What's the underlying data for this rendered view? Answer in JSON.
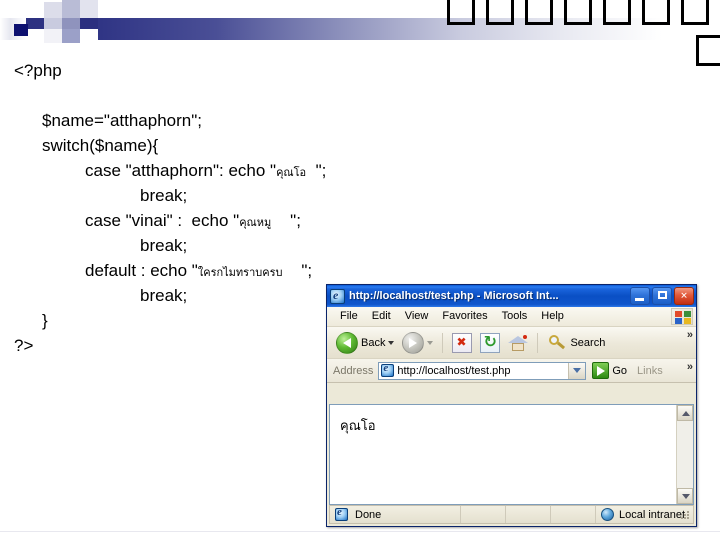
{
  "slide": {
    "title_boxes": 7,
    "title_box_extra": 1,
    "accent_color": "#2b2f7f"
  },
  "code": {
    "lines": [
      {
        "text": "<?php",
        "indent": 0,
        "thai": ""
      },
      {
        "text": "",
        "indent": 0,
        "thai": ""
      },
      {
        "text": "$name=\"atthaphorn\";",
        "indent": 1,
        "thai": ""
      },
      {
        "text": "switch($name){",
        "indent": 1,
        "thai": ""
      },
      {
        "text": "case \"atthaphorn\": echo \"",
        "indent": 2,
        "thai": "คุณโอ",
        "tail": "  \";"
      },
      {
        "text": "break;",
        "indent": 3,
        "thai": ""
      },
      {
        "text": "case \"vinai\" :  echo \"",
        "indent": 2,
        "thai": "คุณหมู",
        "tail": "    \";"
      },
      {
        "text": "break;",
        "indent": 3,
        "thai": ""
      },
      {
        "text": "default : echo \"",
        "indent": 2,
        "thai": "ใครกไมทราบครบ",
        "tail": "    \";"
      },
      {
        "text": "break;",
        "indent": 3,
        "thai": ""
      },
      {
        "text": "}",
        "indent": 1,
        "thai": ""
      },
      {
        "text": "?>",
        "indent": 0,
        "thai": ""
      }
    ]
  },
  "browser": {
    "title": "http://localhost/test.php - Microsoft Int...",
    "window_buttons": {
      "minimize": "_",
      "maximize": "□",
      "close": "✕"
    },
    "menu": [
      "File",
      "Edit",
      "View",
      "Favorites",
      "Tools",
      "Help"
    ],
    "toolbar": {
      "back_label": "Back",
      "forward_label": "",
      "stop_label": "",
      "refresh_label": "",
      "home_label": "",
      "search_label": "Search",
      "overflow": "»"
    },
    "address": {
      "label": "Address",
      "value": "http://localhost/test.php",
      "go_label": "Go",
      "links_label": "Links",
      "overflow": "»"
    },
    "page_content": "คุณโอ",
    "status": {
      "message": "Done",
      "zone": "Local intranet"
    }
  }
}
